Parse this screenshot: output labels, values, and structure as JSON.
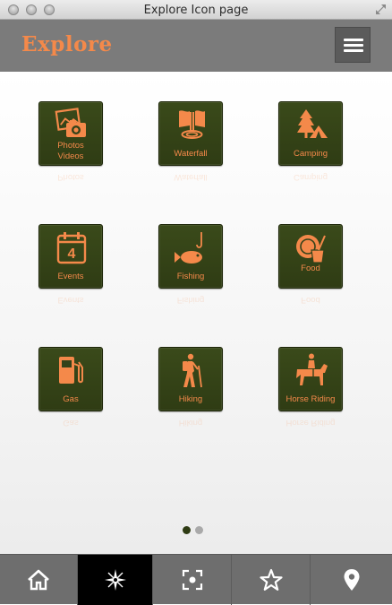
{
  "window": {
    "title": "Explore Icon page"
  },
  "header": {
    "logo": "Explore"
  },
  "tiles": [
    {
      "label_lines": [
        "Photos",
        "Videos"
      ],
      "icon": "photos-videos-icon",
      "reflect": "Photos"
    },
    {
      "label_lines": [
        "Waterfall"
      ],
      "icon": "waterfall-icon",
      "reflect": "Waterfall"
    },
    {
      "label_lines": [
        "Camping"
      ],
      "icon": "camping-icon",
      "reflect": "Camping"
    },
    {
      "label_lines": [
        "Events"
      ],
      "icon": "calendar-icon",
      "reflect": "Events"
    },
    {
      "label_lines": [
        "Fishing"
      ],
      "icon": "fish-icon",
      "reflect": "Fishing"
    },
    {
      "label_lines": [
        "Food"
      ],
      "icon": "food-icon",
      "reflect": "Food"
    },
    {
      "label_lines": [
        "Gas"
      ],
      "icon": "gas-pump-icon",
      "reflect": "Gas"
    },
    {
      "label_lines": [
        "Hiking"
      ],
      "icon": "hiker-icon",
      "reflect": "Hiking"
    },
    {
      "label_lines": [
        "Horse Riding"
      ],
      "icon": "horse-rider-icon",
      "reflect": "Horse Riding"
    }
  ],
  "pager": {
    "pages": 2,
    "active": 1
  },
  "tabbar": {
    "tabs": [
      {
        "icon": "home-icon",
        "active": false
      },
      {
        "icon": "compass-icon",
        "active": true
      },
      {
        "icon": "focus-icon",
        "active": false
      },
      {
        "icon": "star-icon",
        "active": false
      },
      {
        "icon": "map-pin-icon",
        "active": false
      }
    ]
  },
  "colors": {
    "accent": "#f4894a",
    "tile_bg": "#33421a",
    "header_bg": "#7b7b7b",
    "tabbar_bg": "#6e6e6e",
    "tab_active_bg": "#000000"
  }
}
